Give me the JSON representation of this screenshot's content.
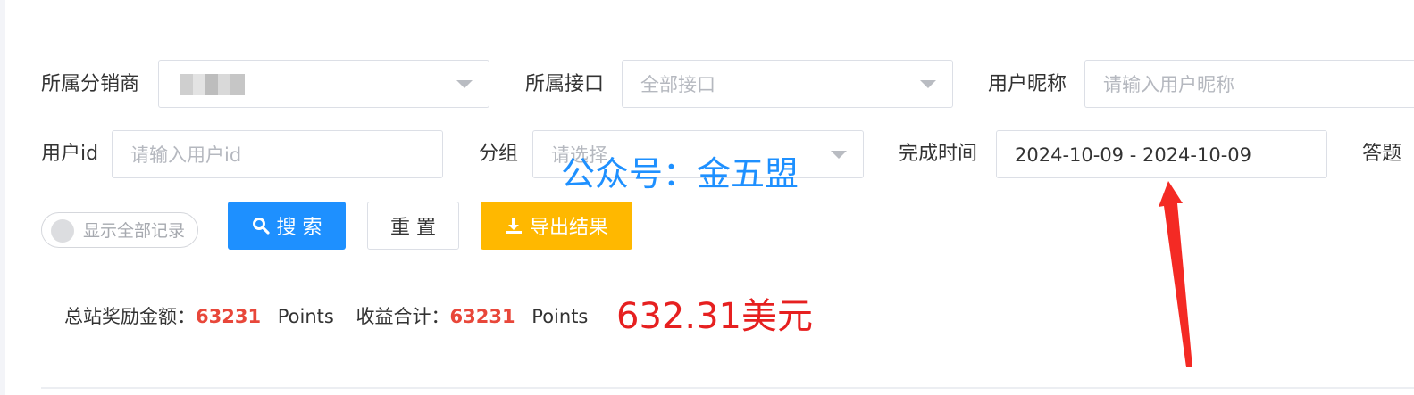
{
  "filters": {
    "distributor_label": "所属分销商",
    "interface_label": "所属接口",
    "interface_value": "全部接口",
    "nickname_label": "用户昵称",
    "nickname_placeholder": "请输入用户昵称",
    "userid_label": "用户id",
    "userid_placeholder": "请输入用户id",
    "group_label": "分组",
    "group_placeholder": "请选择",
    "complete_time_label": "完成时间",
    "complete_time_value": "2024-10-09 - 2024-10-09",
    "answer_label_partial": "答题"
  },
  "toggle": {
    "label": "显示全部记录",
    "on": false
  },
  "buttons": {
    "search": "搜 索",
    "reset": "重 置",
    "export": "导出结果"
  },
  "summary": {
    "total_reward_label": "总站奖励金额：",
    "total_reward_value": "63231",
    "total_reward_unit": "Points",
    "income_total_label": "收益合计：",
    "income_total_value": "63231",
    "income_total_unit": "Points"
  },
  "annotation": {
    "usd_amount": "632.31美元",
    "watermark": "公众号：金五盟"
  },
  "colors": {
    "primary": "#1e90ff",
    "warning": "#ffb800",
    "highlight": "#e8473a",
    "annotation_red": "#e62020"
  },
  "icons": {
    "search": "search-icon",
    "export": "download-icon",
    "caret": "chevron-down-icon",
    "arrow": "arrow-annotation"
  }
}
